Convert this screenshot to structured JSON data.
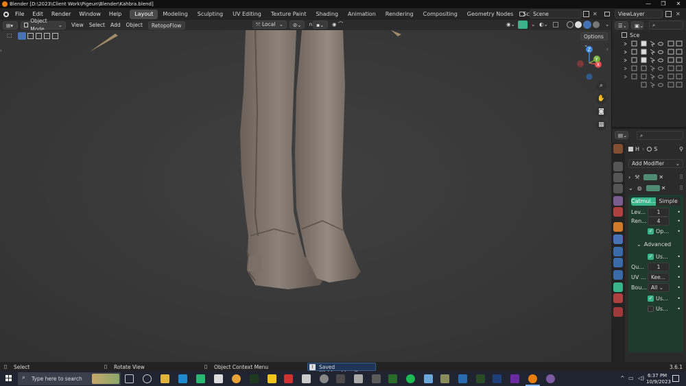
{
  "window": {
    "title": "Blender [D:\\2023\\Client Work\\Pigeun\\Blender\\Kahbra.blend]",
    "minimize": "—",
    "maximize": "❐",
    "close": "✕"
  },
  "menu": {
    "items": [
      "File",
      "Edit",
      "Render",
      "Window",
      "Help"
    ]
  },
  "workspaces": {
    "tabs": [
      "Layout",
      "Modeling",
      "Sculpting",
      "UV Editing",
      "Texture Paint",
      "Shading",
      "Animation",
      "Rendering",
      "Compositing",
      "Geometry Nodes",
      "Scripting"
    ],
    "add": "+",
    "active": "Layout"
  },
  "scene": {
    "name": "Scene"
  },
  "viewlayer": {
    "name": "ViewLayer"
  },
  "header": {
    "mode": "Object Mode",
    "view": "View",
    "select": "Select",
    "add": "Add",
    "object": "Object",
    "addon": "RetopoFlow",
    "orientation": "Local",
    "options": "Options"
  },
  "gizmo": {
    "z": "Z",
    "y": "Y",
    "x": "X"
  },
  "outliner": {
    "root": "Sce"
  },
  "properties": {
    "tabs_header": [
      "H",
      "S"
    ],
    "add_modifier": "Add Modifier",
    "subdiv_types": [
      "Catmul...",
      "Simple"
    ],
    "levels_label": "Lev...",
    "levels_value": "1",
    "render_label": "Ren...",
    "render_value": "4",
    "optimal_label": "Op...",
    "advanced_label": "Advanced",
    "use_limit_label": "Us...",
    "quality_label": "Qu...",
    "quality_value": "1",
    "uv_label": "UV ...",
    "uv_value": "Kee...",
    "boundary_label": "Bou...",
    "boundary_value": "All",
    "use_crease_label": "Us...",
    "use_custom_label": "Us..."
  },
  "statusbar": {
    "select": "Select",
    "rotate": "Rotate View",
    "context": "Object Context Menu",
    "saved": "Saved \"Kahbra.blend\"",
    "version": "3.6.1"
  },
  "taskbar": {
    "search_placeholder": "Type here to search",
    "time": "6:37 PM",
    "date": "10/9/2023"
  },
  "colors": {
    "accent_blue": "#4772b3",
    "active_green": "#3bb38a",
    "blender_orange": "#e87d0d",
    "x_axis": "#e04b4b",
    "y_axis": "#7cb342",
    "z_axis": "#3a86d8"
  }
}
